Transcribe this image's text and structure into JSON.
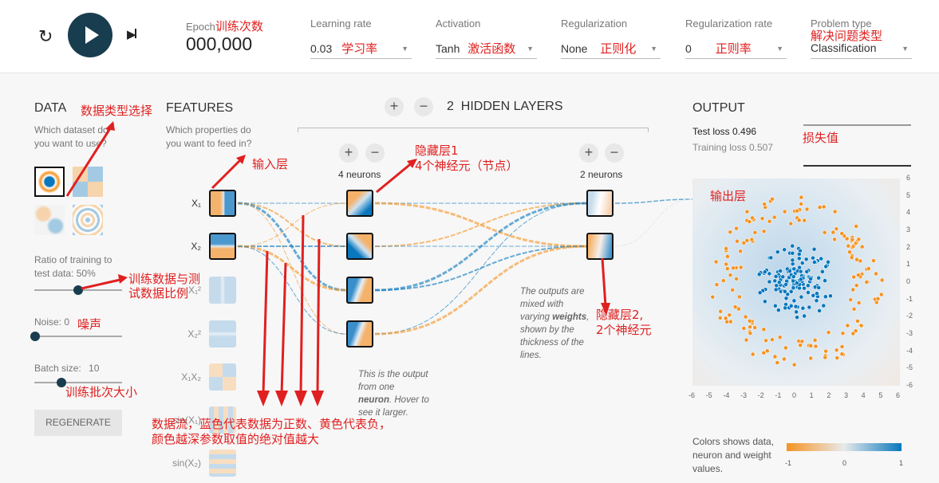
{
  "header": {
    "epoch_label": "Epoch",
    "epoch_note": "训练次数",
    "epoch_value": "000,000",
    "learning_rate": {
      "label": "Learning rate",
      "value": "0.03",
      "note": "学习率"
    },
    "activation": {
      "label": "Activation",
      "value": "Tanh",
      "note": "激活函数"
    },
    "regularization": {
      "label": "Regularization",
      "value": "None",
      "note": "正则化"
    },
    "regularization_rate": {
      "label": "Regularization rate",
      "value": "0",
      "note": "正则率"
    },
    "problem_type": {
      "label": "Problem type",
      "value": "Classification",
      "note": "解决问题类型"
    }
  },
  "data": {
    "title": "DATA",
    "note": "数据类型选择",
    "subtitle": "Which dataset do you want to use?",
    "ratio_label": "Ratio of training to test data:",
    "ratio_value": "50%",
    "ratio": 0.5,
    "ratio_note": "训练数据与测试数据比例",
    "noise_label": "Noise:",
    "noise_value": "0",
    "noise_note": "噪声",
    "batch_label": "Batch size:",
    "batch_value": "10",
    "batch_note": "训练批次大小",
    "regenerate": "REGENERATE"
  },
  "features": {
    "title": "FEATURES",
    "subtitle": "Which properties do you want to feed in?",
    "note": "输入层",
    "items": [
      "X₁",
      "X₂",
      "X₁²",
      "X₂²",
      "X₁X₂",
      "sin(X₁)",
      "sin(X₂)"
    ]
  },
  "network": {
    "hidden_count": "2",
    "hidden_label": "HIDDEN LAYERS",
    "layer1": {
      "neurons": "4 neurons",
      "note1": "隐藏层1",
      "note2": "4个神经元（节点）"
    },
    "layer2": {
      "neurons": "2 neurons",
      "note1": "隐藏层2,",
      "note2": "2个神经元"
    },
    "note_output": [
      "This is the output",
      "from one",
      "neuron",
      ". Hover to",
      "see it larger."
    ],
    "note_weights": [
      "The outputs are",
      "mixed with",
      "varying ",
      "weights",
      ",",
      "shown by the",
      "thickness of the",
      "lines."
    ],
    "flow_note1": "数据流，蓝色代表数据为正数、黄色代表负，",
    "flow_note2": "颜色越深参数取值的绝对值越大"
  },
  "output": {
    "title": "OUTPUT",
    "test_loss_label": "Test loss",
    "test_loss": "0.496",
    "training_loss_label": "Training loss",
    "training_loss": "0.507",
    "loss_note": "损失值",
    "plot_note": "输出层",
    "axis_ticks": [
      "-6",
      "-5",
      "-4",
      "-3",
      "-2",
      "-1",
      "0",
      "1",
      "2",
      "3",
      "4",
      "5",
      "6"
    ],
    "legend_text": "Colors shows data, neuron and weight values.",
    "legend_ticks": [
      "-1",
      "0",
      "1"
    ]
  },
  "colors": {
    "positive": "#0877bd",
    "negative": "#f59322",
    "play": "#183d4e",
    "annotation": "#e02020"
  }
}
